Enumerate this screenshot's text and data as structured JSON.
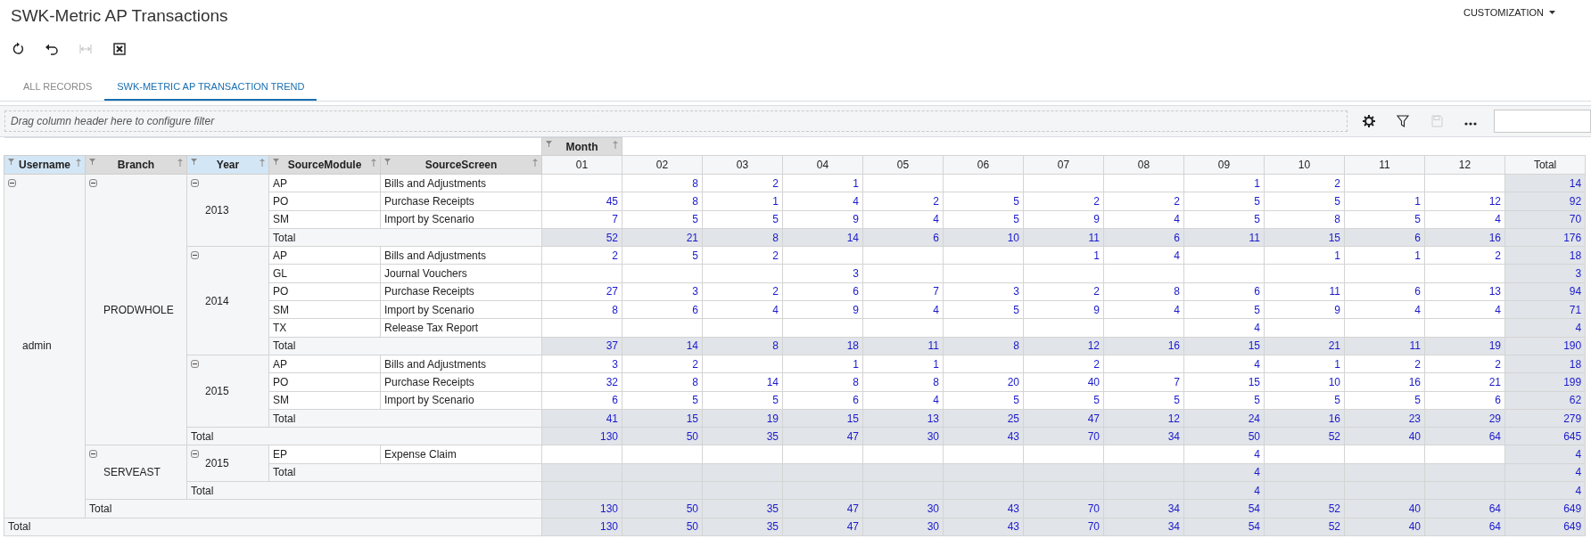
{
  "page_title": "SWK-Metric AP Transactions",
  "customization_menu": "CUSTOMIZATION",
  "toolbar": [
    {
      "kind": "refresh",
      "disabled": false
    },
    {
      "kind": "undo",
      "disabled": false
    },
    {
      "kind": "fit",
      "disabled": true
    },
    {
      "kind": "excel",
      "disabled": false
    }
  ],
  "tabs": [
    {
      "label": "ALL RECORDS",
      "selected": false
    },
    {
      "label": "SWK-METRIC AP TRANSACTION TREND",
      "selected": true
    }
  ],
  "filter_bar": {
    "placeholder": "Drag column header here to configure filter",
    "tools": [
      {
        "kind": "settings",
        "disabled": false
      },
      {
        "kind": "filter",
        "disabled": false
      },
      {
        "kind": "save",
        "disabled": true
      },
      {
        "kind": "more",
        "disabled": false
      }
    ]
  },
  "pivot": {
    "column_field": "Month",
    "row_fields": [
      {
        "label": "Username",
        "highlighted": true
      },
      {
        "label": "Branch",
        "highlighted": false
      },
      {
        "label": "Year",
        "highlighted": true
      },
      {
        "label": "SourceModule",
        "highlighted": false
      },
      {
        "label": "SourceScreen",
        "highlighted": false
      }
    ],
    "columns": [
      "01",
      "02",
      "03",
      "04",
      "05",
      "06",
      "07",
      "08",
      "09",
      "10",
      "11",
      "12",
      "Total"
    ],
    "rows": [
      {
        "label": "admin",
        "expanded": true,
        "children": [
          {
            "label": "PRODWHOLE",
            "expanded": true,
            "children": [
              {
                "label": "2013",
                "expanded": true,
                "children": [
                  {
                    "module": "AP",
                    "screen": "Bills and Adjustments",
                    "values": {
                      "m02": "8",
                      "m03": "2",
                      "m04": "1",
                      "m09": "1",
                      "m10": "2",
                      "total": "14"
                    }
                  },
                  {
                    "module": "PO",
                    "screen": "Purchase Receipts",
                    "values": {
                      "m01": "45",
                      "m02": "8",
                      "m03": "1",
                      "m04": "4",
                      "m05": "2",
                      "m06": "5",
                      "m07": "2",
                      "m08": "2",
                      "m09": "5",
                      "m10": "5",
                      "m11": "1",
                      "m12": "12",
                      "total": "92"
                    }
                  },
                  {
                    "module": "SM",
                    "screen": "Import by Scenario",
                    "values": {
                      "m01": "7",
                      "m02": "5",
                      "m03": "5",
                      "m04": "9",
                      "m05": "4",
                      "m06": "5",
                      "m07": "9",
                      "m08": "4",
                      "m09": "5",
                      "m10": "8",
                      "m11": "5",
                      "m12": "4",
                      "total": "70"
                    }
                  }
                ],
                "total": {
                  "label": "Total",
                  "values": {
                    "m01": "52",
                    "m02": "21",
                    "m03": "8",
                    "m04": "14",
                    "m05": "6",
                    "m06": "10",
                    "m07": "11",
                    "m08": "6",
                    "m09": "11",
                    "m10": "15",
                    "m11": "6",
                    "m12": "16",
                    "total": "176"
                  }
                }
              },
              {
                "label": "2014",
                "expanded": true,
                "children": [
                  {
                    "module": "AP",
                    "screen": "Bills and Adjustments",
                    "values": {
                      "m01": "2",
                      "m02": "5",
                      "m03": "2",
                      "m07": "1",
                      "m08": "4",
                      "m10": "1",
                      "m11": "1",
                      "m12": "2",
                      "total": "18"
                    }
                  },
                  {
                    "module": "GL",
                    "screen": "Journal Vouchers",
                    "values": {
                      "m04": "3",
                      "total": "3"
                    }
                  },
                  {
                    "module": "PO",
                    "screen": "Purchase Receipts",
                    "values": {
                      "m01": "27",
                      "m02": "3",
                      "m03": "2",
                      "m04": "6",
                      "m05": "7",
                      "m06": "3",
                      "m07": "2",
                      "m08": "8",
                      "m09": "6",
                      "m10": "11",
                      "m11": "6",
                      "m12": "13",
                      "total": "94"
                    }
                  },
                  {
                    "module": "SM",
                    "screen": "Import by Scenario",
                    "values": {
                      "m01": "8",
                      "m02": "6",
                      "m03": "4",
                      "m04": "9",
                      "m05": "4",
                      "m06": "5",
                      "m07": "9",
                      "m08": "4",
                      "m09": "5",
                      "m10": "9",
                      "m11": "4",
                      "m12": "4",
                      "total": "71"
                    }
                  },
                  {
                    "module": "TX",
                    "screen": "Release Tax Report",
                    "values": {
                      "m09": "4",
                      "total": "4"
                    }
                  }
                ],
                "total": {
                  "label": "Total",
                  "values": {
                    "m01": "37",
                    "m02": "14",
                    "m03": "8",
                    "m04": "18",
                    "m05": "11",
                    "m06": "8",
                    "m07": "12",
                    "m08": "16",
                    "m09": "15",
                    "m10": "21",
                    "m11": "11",
                    "m12": "19",
                    "total": "190"
                  }
                }
              },
              {
                "label": "2015",
                "expanded": true,
                "children": [
                  {
                    "module": "AP",
                    "screen": "Bills and Adjustments",
                    "values": {
                      "m01": "3",
                      "m02": "2",
                      "m04": "1",
                      "m05": "1",
                      "m07": "2",
                      "m09": "4",
                      "m10": "1",
                      "m11": "2",
                      "m12": "2",
                      "total": "18"
                    }
                  },
                  {
                    "module": "PO",
                    "screen": "Purchase Receipts",
                    "values": {
                      "m01": "32",
                      "m02": "8",
                      "m03": "14",
                      "m04": "8",
                      "m05": "8",
                      "m06": "20",
                      "m07": "40",
                      "m08": "7",
                      "m09": "15",
                      "m10": "10",
                      "m11": "16",
                      "m12": "21",
                      "total": "199"
                    }
                  },
                  {
                    "module": "SM",
                    "screen": "Import by Scenario",
                    "values": {
                      "m01": "6",
                      "m02": "5",
                      "m03": "5",
                      "m04": "6",
                      "m05": "4",
                      "m06": "5",
                      "m07": "5",
                      "m08": "5",
                      "m09": "5",
                      "m10": "5",
                      "m11": "5",
                      "m12": "6",
                      "total": "62"
                    }
                  }
                ],
                "total": {
                  "label": "Total",
                  "values": {
                    "m01": "41",
                    "m02": "15",
                    "m03": "19",
                    "m04": "15",
                    "m05": "13",
                    "m06": "25",
                    "m07": "47",
                    "m08": "12",
                    "m09": "24",
                    "m10": "16",
                    "m11": "23",
                    "m12": "29",
                    "total": "279"
                  }
                }
              }
            ],
            "total": {
              "label": "Total",
              "values": {
                "m01": "130",
                "m02": "50",
                "m03": "35",
                "m04": "47",
                "m05": "30",
                "m06": "43",
                "m07": "70",
                "m08": "34",
                "m09": "50",
                "m10": "52",
                "m11": "40",
                "m12": "64",
                "total": "645"
              }
            }
          },
          {
            "label": "SERVEAST",
            "expanded": true,
            "children": [
              {
                "label": "2015",
                "expanded": true,
                "children": [
                  {
                    "module": "EP",
                    "screen": "Expense Claim",
                    "values": {
                      "m09": "4",
                      "total": "4"
                    }
                  }
                ],
                "total": {
                  "label": "Total",
                  "values": {
                    "m09": "4",
                    "total": "4"
                  }
                }
              }
            ],
            "total": {
              "label": "Total",
              "values": {
                "m09": "4",
                "total": "4"
              }
            }
          }
        ],
        "total": {
          "label": "Total",
          "values": {
            "m01": "130",
            "m02": "50",
            "m03": "35",
            "m04": "47",
            "m05": "30",
            "m06": "43",
            "m07": "70",
            "m08": "34",
            "m09": "54",
            "m10": "52",
            "m11": "40",
            "m12": "64",
            "total": "649"
          }
        }
      }
    ],
    "grand_total": {
      "label": "Total",
      "values": {
        "m01": "130",
        "m02": "50",
        "m03": "35",
        "m04": "47",
        "m05": "30",
        "m06": "43",
        "m07": "70",
        "m08": "34",
        "m09": "54",
        "m10": "52",
        "m11": "40",
        "m12": "64",
        "total": "649"
      }
    }
  }
}
